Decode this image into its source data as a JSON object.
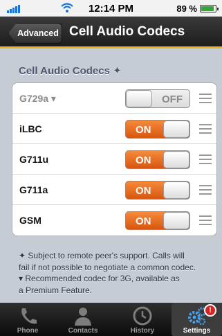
{
  "status_bar": {
    "time": "12:14 PM",
    "battery_percent": "89 %",
    "battery_level": 0.89
  },
  "navbar": {
    "back_label": "Advanced",
    "title": "Cell Audio Codecs",
    "accent_color": "#f2b21f"
  },
  "section": {
    "header": "Cell Audio Codecs ✦"
  },
  "codecs": [
    {
      "name": "G729a ▾",
      "state": "OFF",
      "enabled": false
    },
    {
      "name": "iLBC",
      "state": "ON",
      "enabled": true
    },
    {
      "name": "G711u",
      "state": "ON",
      "enabled": true
    },
    {
      "name": "G711a",
      "state": "ON",
      "enabled": true
    },
    {
      "name": "GSM",
      "state": "ON",
      "enabled": true
    }
  ],
  "footnotes": [
    "✦ Subject to remote peer's support. Calls will",
    "fail if not possible to negotiate a common codec.",
    "▾ Recommended codec for 3G, available as",
    "a Premium Feature."
  ],
  "tabbar": {
    "tabs": [
      {
        "label": "Phone",
        "icon": "phone-icon",
        "active": false
      },
      {
        "label": "Contacts",
        "icon": "contacts-icon",
        "active": false
      },
      {
        "label": "History",
        "icon": "clock-icon",
        "active": false
      },
      {
        "label": "Settings",
        "icon": "gears-icon",
        "active": true
      }
    ],
    "settings_badge": "!"
  }
}
